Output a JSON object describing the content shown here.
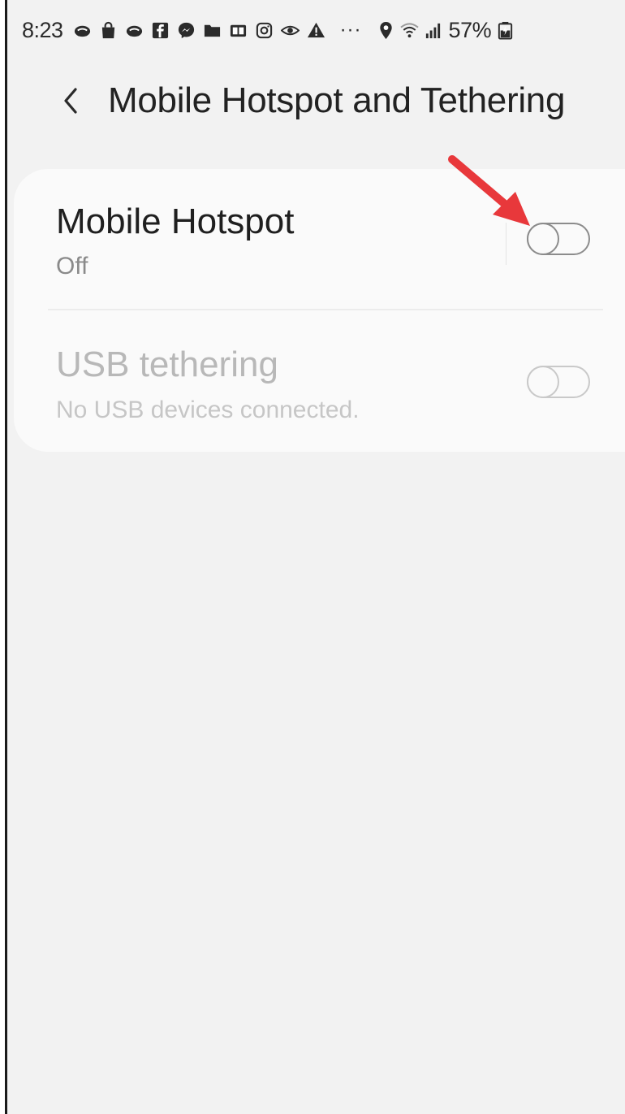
{
  "status_bar": {
    "time": "8:23",
    "notification_icons": [
      "cloud-icon",
      "shopping-bag-icon",
      "cloud-icon",
      "facebook-icon",
      "messenger-icon",
      "folder-icon",
      "video-icon",
      "instagram-icon",
      "eye-icon",
      "warning-icon"
    ],
    "more_indicator": "···",
    "battery_percent": "57%",
    "system_icons": [
      "location-icon",
      "wifi-icon",
      "signal-icon",
      "battery-icon"
    ]
  },
  "header": {
    "back_icon": "chevron-left-icon",
    "title": "Mobile Hotspot and Tethering"
  },
  "settings": {
    "mobile_hotspot": {
      "title": "Mobile Hotspot",
      "subtitle": "Off",
      "toggle_on": false,
      "enabled": true
    },
    "usb_tethering": {
      "title": "USB tethering",
      "subtitle": "No USB devices connected.",
      "toggle_on": false,
      "enabled": false
    }
  },
  "annotation": {
    "color": "#e8383b"
  },
  "colors": {
    "background": "#f2f2f2",
    "card": "#fafafa",
    "title_text": "#1f1f1f",
    "subtitle_text": "#8a8a8a",
    "disabled_text": "#b8b8b8"
  }
}
